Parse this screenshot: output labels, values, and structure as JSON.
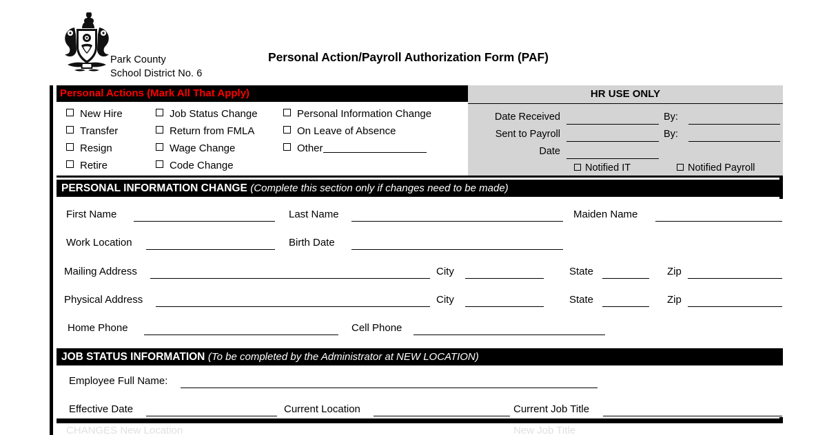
{
  "header": {
    "org_line1": "Park County",
    "org_line2": "School District No. 6",
    "title": "Personal Action/Payroll Authorization Form (PAF)",
    "logo_icon": "coat-of-arms-crest"
  },
  "personal_actions": {
    "heading": "Personal Actions (Mark All That Apply)",
    "heading_color": "#ff0000",
    "column1": [
      "New Hire",
      "Transfer",
      "Resign",
      "Retire"
    ],
    "column2": [
      "Job Status Change",
      "Return from FMLA",
      "Wage Change",
      "Code Change"
    ],
    "column3": [
      "Personal Information Change",
      "On Leave of Absence",
      "Other"
    ]
  },
  "hr_use_only": {
    "heading": "HR USE ONLY",
    "rows": [
      {
        "label": "Date Received",
        "by_label": "By:"
      },
      {
        "label": "Sent to Payroll",
        "by_label": "By:"
      },
      {
        "label": "Date",
        "by_label": ""
      }
    ],
    "checkboxes": [
      "Notified IT",
      "Notified Payroll"
    ]
  },
  "personal_info_change": {
    "heading": "PERSONAL INFORMATION CHANGE",
    "note": "(Complete this section only if changes need to be made)",
    "fields": {
      "first_name": "First Name",
      "last_name": "Last Name",
      "maiden_name": "Maiden Name",
      "work_location": "Work Location",
      "birth_date": "Birth Date",
      "mailing_address": "Mailing Address",
      "physical_address": "Physical Address",
      "city": "City",
      "state": "State",
      "zip": "Zip",
      "home_phone": "Home Phone",
      "cell_phone": "Cell Phone"
    }
  },
  "job_status_information": {
    "heading": "JOB STATUS INFORMATION",
    "note": "(To be completed by the Administrator at NEW LOCATION)",
    "fields": {
      "employee_full_name": "Employee Full Name:",
      "effective_date": "Effective Date",
      "current_location": "Current Location",
      "current_job_title": "Current Job Title"
    },
    "clipped_row": {
      "left": "CHANGES     New Location",
      "right": "New Job Title"
    }
  }
}
